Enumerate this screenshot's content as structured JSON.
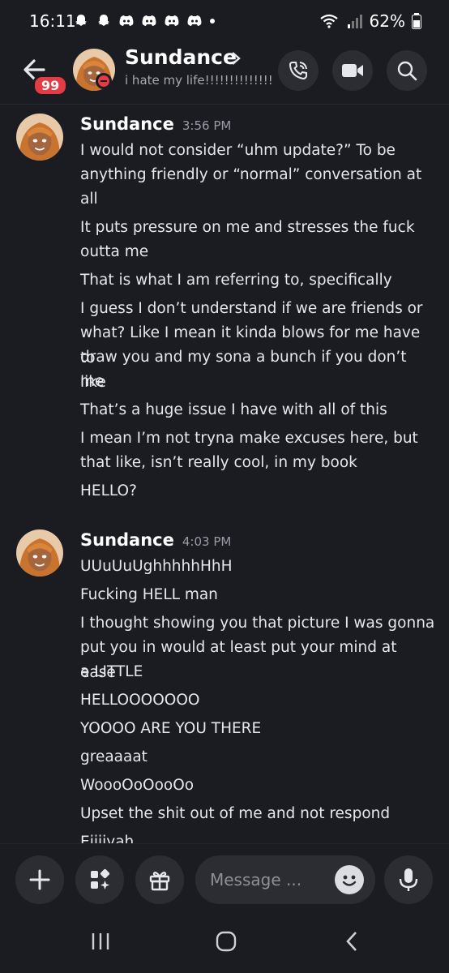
{
  "status_bar": {
    "time": "16:11",
    "battery": "62%"
  },
  "header": {
    "unread_badge": "99",
    "name": "Sundance",
    "status": "i hate my life!!!!!!!!!!!!!! l..."
  },
  "groups": [
    {
      "author": "Sundance",
      "time": "3:56 PM",
      "lines": [
        "I would not consider “uhm update?” To be",
        "anything friendly or “normal” conversation at",
        "all",
        "It puts pressure on me and stresses the fuck",
        "outta me",
        "That is what I am referring to, specifically",
        "I guess I don’t understand if we are friends or",
        "what? Like I mean it kinda blows for me have to",
        "draw you and my sona a bunch if you don’t like",
        "me",
        "That’s a huge issue I have with all of this",
        "I mean I’m not tryna make excuses here, but",
        "that like, isn’t really cool, in my book",
        "HELLO?"
      ]
    },
    {
      "author": "Sundance",
      "time": "4:03 PM",
      "lines": [
        "UUuUuUghhhhhHhH",
        "Fucking HELL man",
        "I thought showing you that picture I was gonna",
        "put you in would at least put your mind at ease",
        "a LITTLE",
        "HELLOOOOOOO",
        "YOOOO ARE YOU THERE",
        "greaaaat",
        "WoooOoOooOo",
        "Upset the shit out of me and not respond",
        "Eiiiiyah"
      ]
    }
  ],
  "composer": {
    "placeholder": "Message ..."
  },
  "icons": [
    "back-arrow-icon",
    "phone-icon",
    "video-icon",
    "search-icon",
    "plus-icon",
    "apps-icon",
    "gift-icon",
    "emoji-icon",
    "mic-icon",
    "recents-icon",
    "home-icon",
    "back-nav-icon"
  ]
}
